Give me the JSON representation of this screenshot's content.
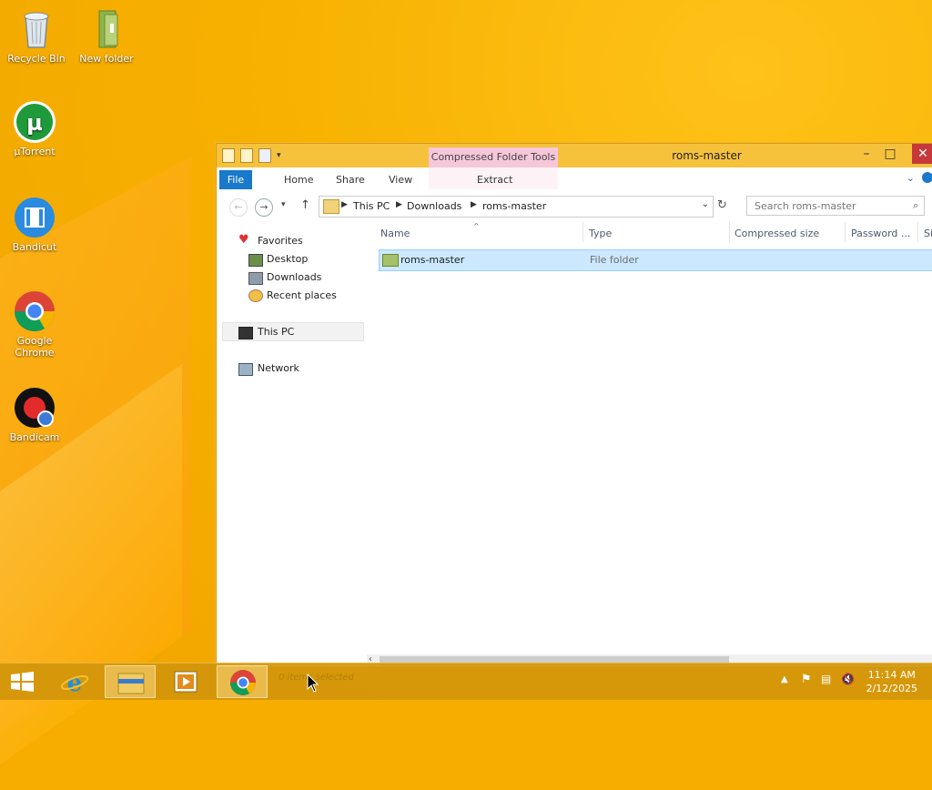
{
  "desktop": {
    "icons": [
      {
        "label": "Recycle Bin",
        "icon": "recycle-bin-icon"
      },
      {
        "label": "New folder",
        "icon": "folder-icon"
      },
      {
        "label": "µTorrent",
        "icon": "utorrent-icon"
      },
      {
        "label": "Bandicut",
        "icon": "bandicut-icon"
      },
      {
        "label": "Google Chrome",
        "icon": "chrome-icon"
      },
      {
        "label": "Bandicam",
        "icon": "bandicam-icon"
      }
    ]
  },
  "window": {
    "title": "roms-master",
    "context_tab_group": "Compressed Folder Tools",
    "ribbon_tabs": [
      "File",
      "Home",
      "Share",
      "View",
      "Extract"
    ],
    "breadcrumb": [
      "This PC",
      "Downloads",
      "roms-master"
    ],
    "search_placeholder": "Search roms-master",
    "nav": {
      "favorites": "Favorites",
      "desktop": "Desktop",
      "downloads": "Downloads",
      "recent": "Recent places",
      "this_pc": "This PC",
      "network": "Network"
    },
    "columns": [
      "Name",
      "Type",
      "Compressed size",
      "Password ...",
      "Si"
    ],
    "rows": [
      {
        "name": "roms-master",
        "type": "File folder"
      }
    ]
  },
  "taskbar": {
    "time": "11:14 AM",
    "date": "2/12/2025",
    "ghost_text": "0 items selected"
  },
  "colors": {
    "accent": "#1979ca",
    "wallpaper": "#f6ad00",
    "selection": "#cce8ff",
    "close": "#c7383a"
  }
}
